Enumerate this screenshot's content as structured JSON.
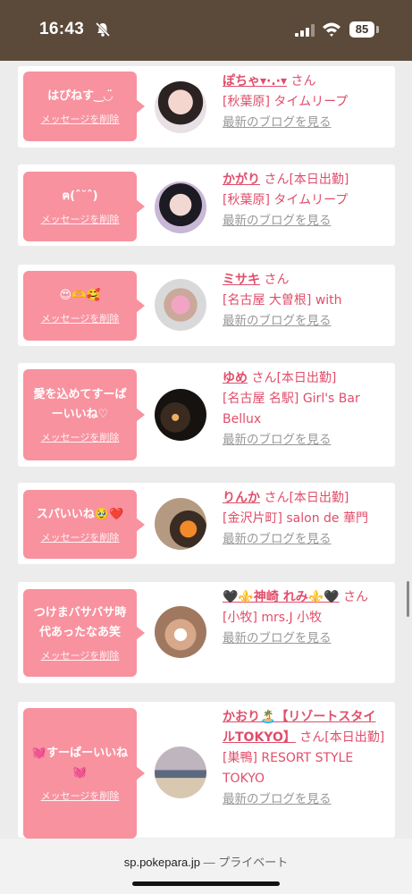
{
  "status": {
    "time": "16:43",
    "battery": "85"
  },
  "browser": {
    "domain": "sp.pokepara.jp",
    "separator": " — ",
    "privacy": "プライベート"
  },
  "items": [
    {
      "message": "はぴねす‿◡̈",
      "delete": "メッセージを削除",
      "name": "ぽちゃ▾·.·▾",
      "san": "さん",
      "status": "",
      "shop": "[秋葉原] タイムリープ",
      "blog": "最新のブログを見る"
    },
    {
      "message": "ฅ(ˆ˘ˆ)",
      "delete": "メッセージを削除",
      "name": "かがり",
      "san": "さん",
      "status": "[本日出勤]",
      "shop": "[秋葉原] タイムリープ",
      "blog": "最新のブログを見る"
    },
    {
      "message": "😍🫶🥰",
      "delete": "メッセージを削除",
      "name": "ミサキ",
      "san": "さん",
      "status": "",
      "shop": "[名古屋 大曽根] with",
      "blog": "最新のブログを見る"
    },
    {
      "message": "愛を込めてすーぱーいいね♡",
      "delete": "メッセージを削除",
      "name": "ゆめ",
      "san": "さん",
      "status": "[本日出勤]",
      "shop": "[名古屋 名駅] Girl's Bar Bellux",
      "blog": "最新のブログを見る"
    },
    {
      "message": "スパいいね🥹❤️",
      "delete": "メッセージを削除",
      "name": "りんか",
      "san": "さん",
      "status": "[本日出勤]",
      "shop": "[金沢片町] salon de 華門",
      "blog": "最新のブログを見る"
    },
    {
      "message": "つけまバサバサ時代あったなあ笑",
      "delete": "メッセージを削除",
      "name": "🖤⚜️神崎 れみ⚜️🖤",
      "san": "さん",
      "status": "",
      "shop": "[小牧] mrs.J 小牧",
      "blog": "最新のブログを見る"
    },
    {
      "message": "💓すーぱーいいね💓",
      "delete": "メッセージを削除",
      "name": "かおり🏝️【リゾートスタイルTOKYO】",
      "san": "さん",
      "status": "[本日出勤]",
      "shop": "[巣鴨] RESORT STYLE TOKYO",
      "blog": "最新のブログを見る"
    }
  ]
}
